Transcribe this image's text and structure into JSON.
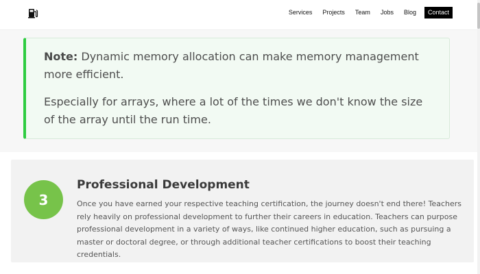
{
  "header": {
    "logo_icon": "fuel-pump-icon",
    "nav": {
      "services": "Services",
      "projects": "Projects",
      "team": "Team",
      "jobs": "Jobs",
      "blog": "Blog",
      "contact": "Contact"
    }
  },
  "note": {
    "label": "Note:",
    "text1": " Dynamic memory allocation can make memory management more efficient.",
    "text2": "Especially for arrays, where a lot of the times we don't know the size of the array until the run time.",
    "accent_color": "#2ecc40"
  },
  "step": {
    "number": "3",
    "title": "Professional Development",
    "body": "Once you have earned your respective teaching certification, the journey doesn't end there! Teachers rely heavily on professional development to further their careers in education. Teachers can purpose professional development in a variety of ways, like continued higher education, such as pursuing a master or doctoral degree, or through additional teacher certifications to boost their teaching credentials.",
    "circle_color": "#77c34a"
  }
}
